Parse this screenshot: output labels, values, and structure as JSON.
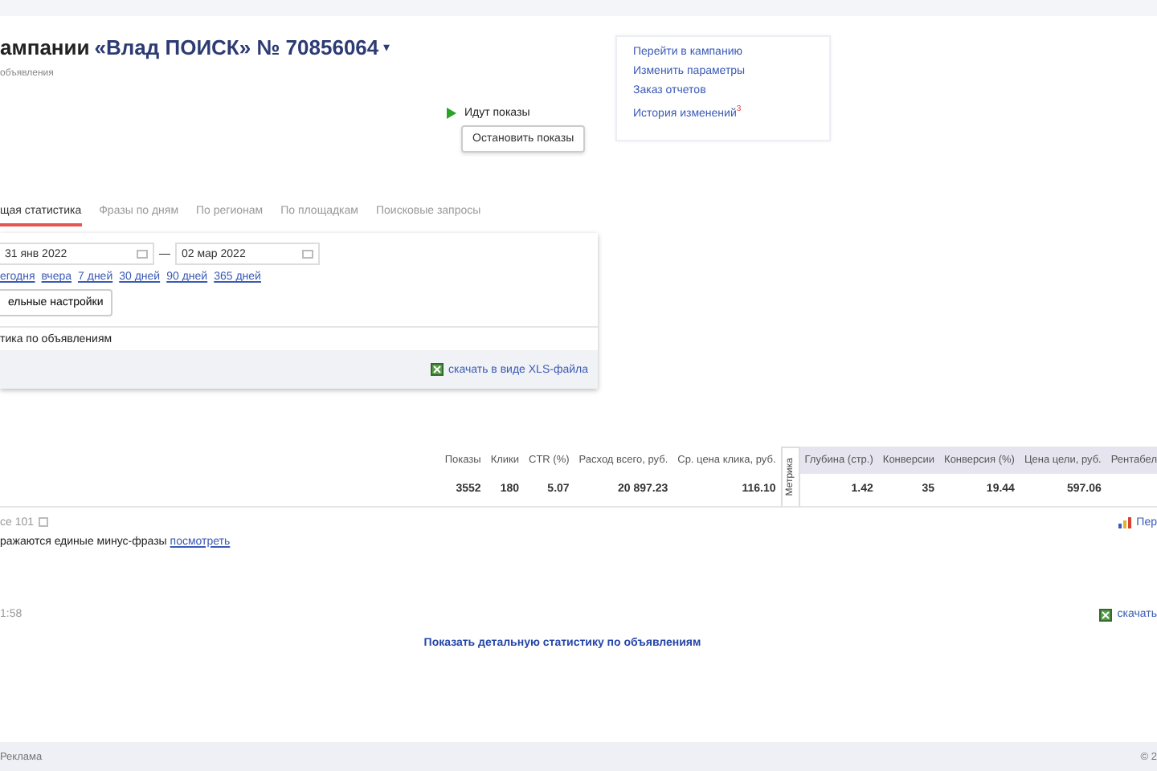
{
  "header": {
    "title_prefix": "ампании",
    "title_name": "«Влад ПОИСК» № 70856064",
    "caret": "▾",
    "subtitle": "объявления"
  },
  "status": {
    "text": "Идут показы",
    "running": true
  },
  "stop_button": "Остановить показы",
  "links": [
    {
      "label": "Перейти в кампанию"
    },
    {
      "label": "Изменить параметры"
    },
    {
      "label": "Заказ отчетов"
    },
    {
      "label": "История изменений",
      "badge": "3"
    }
  ],
  "tabs": [
    {
      "label": "щая статистика",
      "selected": true
    },
    {
      "label": "Фразы по дням",
      "selected": false
    },
    {
      "label": "По регионам",
      "selected": false
    },
    {
      "label": "По площадкам",
      "selected": false
    },
    {
      "label": "Поисковые запросы",
      "selected": false
    }
  ],
  "period": {
    "date_from": "31 янв 2022",
    "separator": "—",
    "date_to": "02 мар 2022",
    "quick": [
      "егодня",
      "вчера",
      "7 дней",
      "30 дней",
      "90 дней",
      "365 дней"
    ]
  },
  "settings_button": "ельные настройки",
  "section_label": "тика по объявлениям",
  "xls_link": "скачать в виде XLS-файла",
  "table": {
    "columns": [
      {
        "label": "Показы",
        "kind": "main"
      },
      {
        "label": "Клики",
        "kind": "main"
      },
      {
        "label": "CTR (%)",
        "kind": "main"
      },
      {
        "label": "Расход всего, руб.",
        "kind": "main"
      },
      {
        "label": "Ср. цена клика, руб.",
        "kind": "main"
      },
      {
        "label": "Глубина (стр.)",
        "kind": "metrika"
      },
      {
        "label": "Конверсии",
        "kind": "metrika"
      },
      {
        "label": "Конверсия (%)",
        "kind": "metrika"
      },
      {
        "label": "Цена цели, руб.",
        "kind": "metrika"
      },
      {
        "label": "Рентабел",
        "kind": "metrika"
      }
    ],
    "rows": [
      [
        "3552",
        "180",
        "5.07",
        "20 897.23",
        "116.10",
        "1.42",
        "35",
        "19.44",
        "597.06"
      ]
    ],
    "metrika_toggle": "Метрика"
  },
  "phrases": {
    "count": "се 101",
    "note": "ражаются единые минус-фразы",
    "note_link": "посмотреть",
    "right_link": "Пер"
  },
  "time": "1:58",
  "download_link": "скачать",
  "detail_link": "Показать детальную статистику по объявлениям",
  "footer": {
    "left": "Реклама",
    "right": "© 2"
  }
}
